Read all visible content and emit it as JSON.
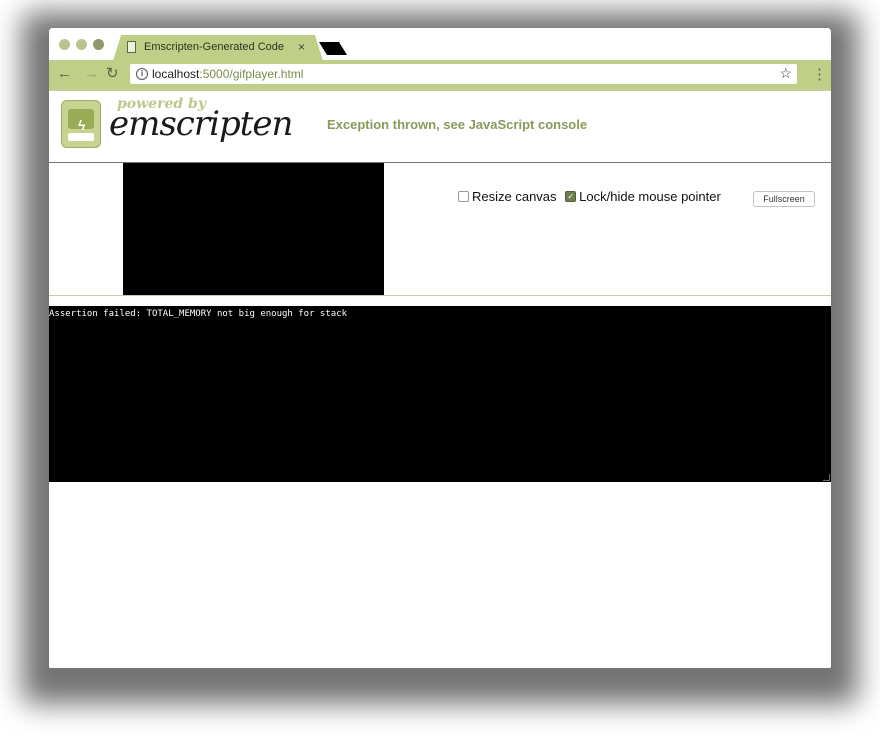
{
  "browser": {
    "tab_title": "Emscripten-Generated Code",
    "tab_close": "×",
    "url_host": "localhost",
    "url_rest": ":5000/gifplayer.html",
    "info_icon": "i",
    "back_icon": "←",
    "forward_icon": "→",
    "reload_icon": "↻",
    "star_icon": "☆",
    "menu_icon": "⋮"
  },
  "header": {
    "powered_by": "powered by",
    "brand": "emscripten",
    "status": "Exception thrown, see JavaScript console"
  },
  "controls": {
    "resize_label": "Resize canvas",
    "resize_checked": false,
    "lock_label": "Lock/hide mouse pointer",
    "lock_checked": true,
    "fullscreen_label": "Fullscreen"
  },
  "console": {
    "output": "Assertion failed: TOTAL_MEMORY not big enough for stack"
  },
  "colors": {
    "accent": "#bfcf87",
    "status_text": "#8a9a5a"
  }
}
